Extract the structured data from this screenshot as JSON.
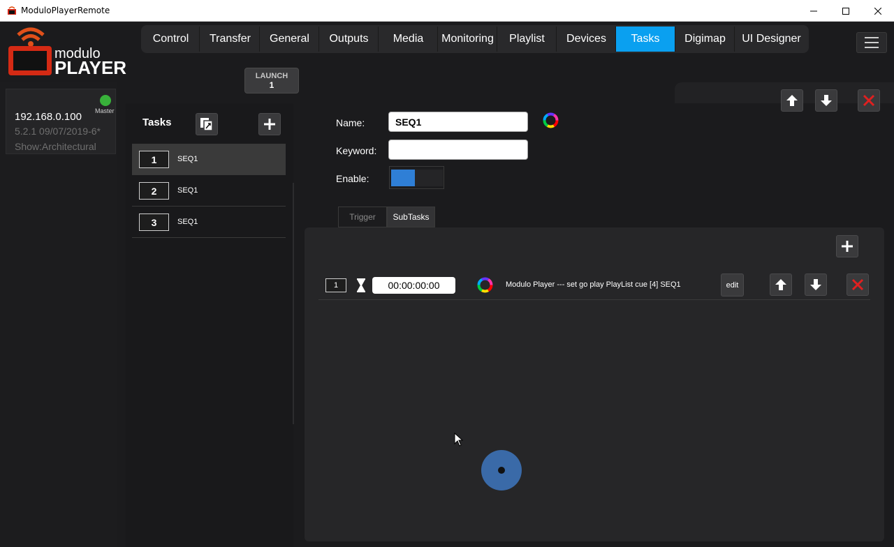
{
  "window": {
    "title": "ModuloPlayerRemote"
  },
  "nav": {
    "tabs": [
      {
        "label": "Control"
      },
      {
        "label": "Transfer"
      },
      {
        "label": "General"
      },
      {
        "label": "Outputs"
      },
      {
        "label": "Media"
      },
      {
        "label": "Monitoring"
      },
      {
        "label": "Playlist"
      },
      {
        "label": "Devices"
      },
      {
        "label": "Tasks",
        "active": true
      },
      {
        "label": "Digimap"
      },
      {
        "label": "UI Designer"
      }
    ]
  },
  "logo": {
    "line1": "modulo",
    "line2": "PLAYER"
  },
  "launch": {
    "label": "LAUNCH",
    "value": "1"
  },
  "device": {
    "ip": "192.168.0.100",
    "version": "5.2.1 09/07/2019-6*",
    "show": "Show:Architectural",
    "master_label": "Master",
    "status_color": "#38b13a"
  },
  "tasks": {
    "title": "Tasks",
    "items": [
      {
        "num": "1",
        "name": "SEQ1"
      },
      {
        "num": "2",
        "name": "SEQ1"
      },
      {
        "num": "3",
        "name": "SEQ1"
      }
    ]
  },
  "detail": {
    "name_label": "Name:",
    "name_value": "SEQ1",
    "keyword_label": "Keyword:",
    "keyword_value": "",
    "enable_label": "Enable:",
    "subtabs": {
      "trigger": "Trigger",
      "subtasks": "SubTasks"
    }
  },
  "subtasks": {
    "items": [
      {
        "num": "1",
        "time": "00:00:00:00",
        "description": "Modulo Player --- set go play PlayList cue [4]   SEQ1",
        "edit_label": "edit"
      }
    ]
  },
  "colors": {
    "accent": "#0aa0f0",
    "delete": "#e02020",
    "toggle_on": "#2f7fd6"
  }
}
